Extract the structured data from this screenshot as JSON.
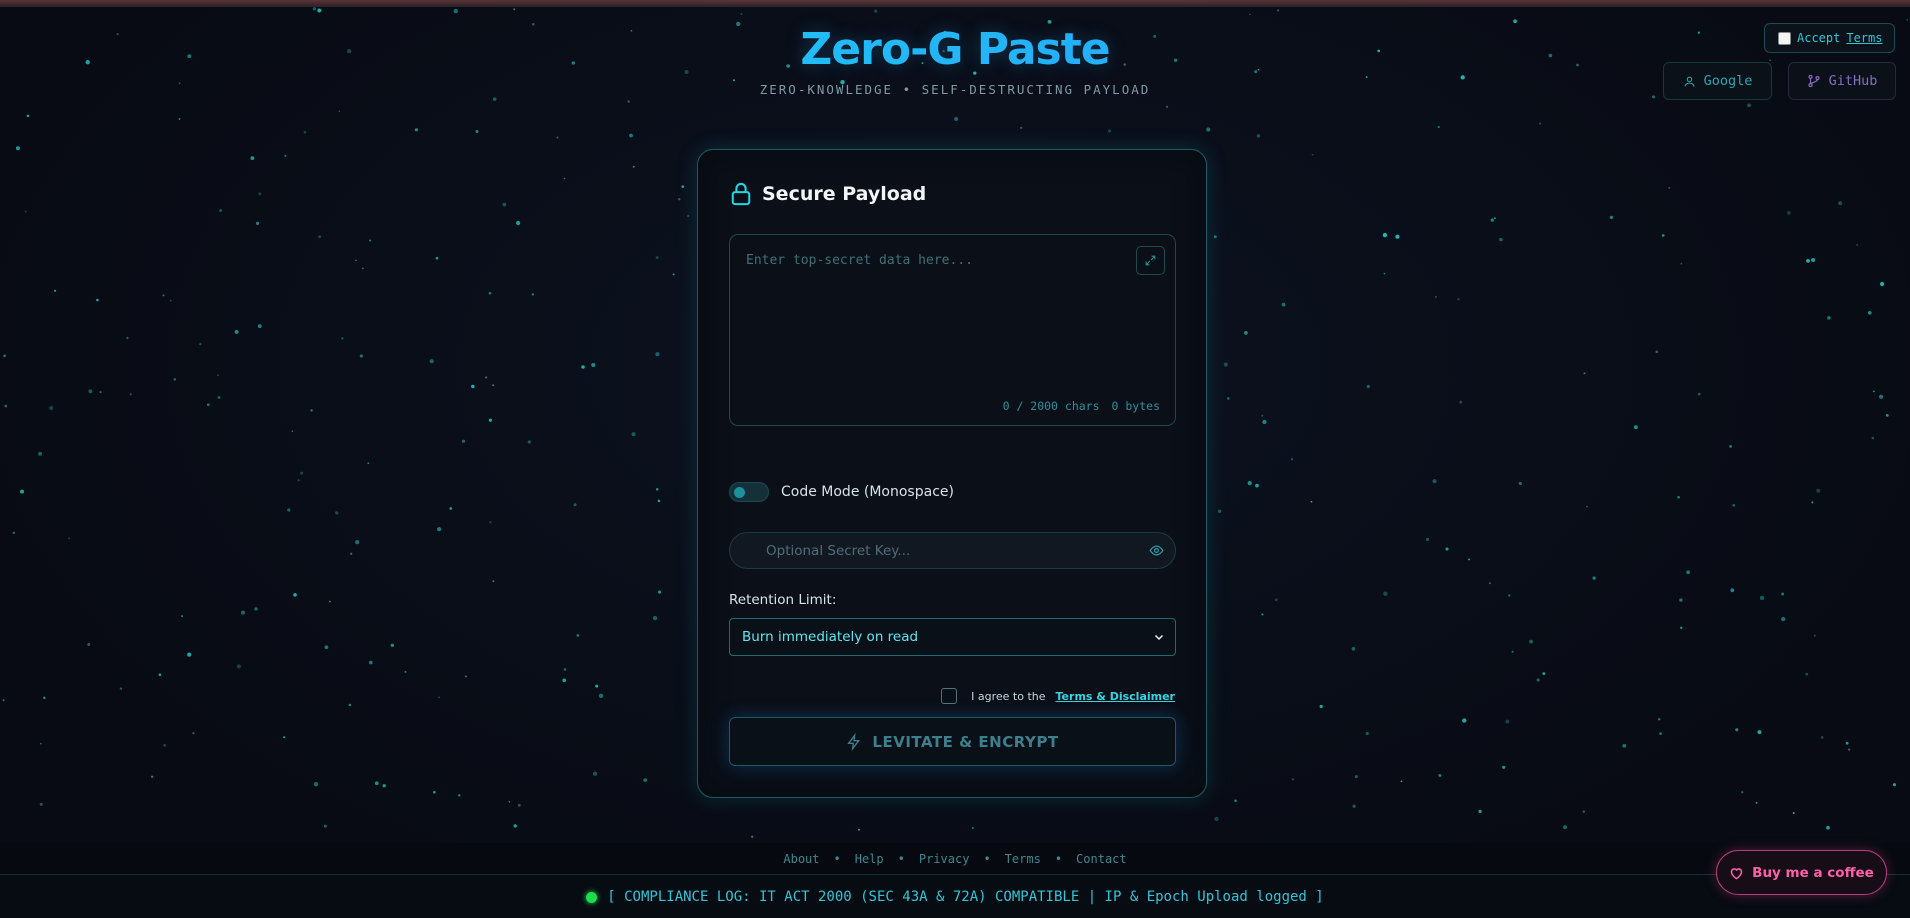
{
  "header": {
    "title": "Zero-G Paste",
    "subtitle": "ZERO-KNOWLEDGE • SELF-DESTRUCTING PAYLOAD"
  },
  "top_right": {
    "accept_label": "Accept",
    "terms_link": "Terms",
    "google_label": "Google",
    "github_label": "GitHub"
  },
  "card": {
    "title": "Secure Payload",
    "editor_placeholder": "Enter top-secret data here...",
    "char_count": "0 / 2000 chars",
    "byte_count": "0 bytes",
    "code_mode_label": "Code Mode (Monospace)",
    "secret_placeholder": "Optional Secret Key...",
    "retention_label": "Retention Limit:",
    "retention_selected": "Burn immediately on read",
    "agree_text": "I agree to the",
    "agree_link": "Terms & Disclaimer",
    "encrypt_button": "LEVITATE & ENCRYPT"
  },
  "footer": {
    "links": [
      "About",
      "Help",
      "Privacy",
      "Terms",
      "Contact"
    ],
    "compliance": "[ COMPLIANCE LOG: IT ACT 2000 (SEC 43A & 72A) COMPATIBLE | IP & Epoch Upload logged ]"
  },
  "coffee_button": "Buy me a coffee",
  "icons": {
    "lock": "lock-icon",
    "expand": "expand-icon",
    "eye": "eye-icon",
    "bolt": "bolt-icon",
    "user": "user-icon",
    "git_branch": "git-branch-icon",
    "heart": "heart-icon"
  },
  "colors": {
    "accent_cyan": "#19e3f0",
    "accent_blue": "#2f8cff",
    "background": "#090d16",
    "status_green": "#1edc4b",
    "coffee_pink": "#ff5fa8"
  }
}
